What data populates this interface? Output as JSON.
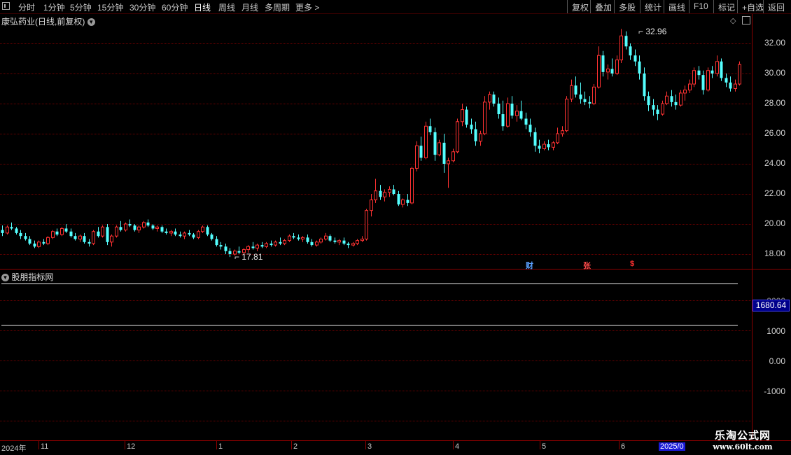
{
  "toolbar": {
    "periods": [
      "分时",
      "1分钟",
      "5分钟",
      "15分钟",
      "30分钟",
      "60分钟",
      "日线",
      "周线",
      "月线",
      "多周期",
      "更多 >"
    ],
    "active_period": "日线",
    "right_buttons": [
      "复权",
      "叠加",
      "多股",
      "统计",
      "画线",
      "F10",
      "标记",
      "+自选",
      "返回"
    ]
  },
  "title": "康弘药业(日线,前复权)",
  "indicator_title": "股朋指标网",
  "price_axis": [
    "32.00",
    "30.00",
    "28.00",
    "26.00",
    "24.00",
    "22.00",
    "20.00",
    "18.00"
  ],
  "high_label": "32.96",
  "low_label": "17.81",
  "indicator_axis": [
    "2000",
    "1000",
    "0.00",
    "-1000"
  ],
  "indicator_current": "1680.64",
  "events": [
    {
      "label": "财",
      "color": "#5aa0ff"
    },
    {
      "label": "张",
      "color": "#ff4a4a"
    },
    {
      "label": "$",
      "color": "#ff3030"
    }
  ],
  "date_axis": [
    "2024年",
    "11",
    "12",
    "1",
    "2",
    "3",
    "4",
    "5",
    "6",
    "2025/0"
  ],
  "watermark": {
    "cn": "乐淘公式网",
    "url": "www.60lt.com"
  },
  "colors": {
    "up": "#ff3232",
    "down": "#54ffff",
    "grid": "#6e0000",
    "axis": "#8b0000"
  },
  "chart_data": {
    "type": "candlestick",
    "ylim": [
      17,
      33
    ],
    "high": 32.96,
    "low": 17.81,
    "candles": [
      [
        19.6,
        19.9,
        19.2,
        19.4
      ],
      [
        19.4,
        19.9,
        19.3,
        19.8
      ],
      [
        19.8,
        20.1,
        19.6,
        19.7
      ],
      [
        19.7,
        19.8,
        19.3,
        19.4
      ],
      [
        19.4,
        19.6,
        19.0,
        19.2
      ],
      [
        19.2,
        19.4,
        18.9,
        19.0
      ],
      [
        19.0,
        19.2,
        18.6,
        18.7
      ],
      [
        18.7,
        18.9,
        18.4,
        18.5
      ],
      [
        18.5,
        18.9,
        18.4,
        18.8
      ],
      [
        18.8,
        19.0,
        18.6,
        18.7
      ],
      [
        18.7,
        19.2,
        18.6,
        19.1
      ],
      [
        19.1,
        19.6,
        19.0,
        19.5
      ],
      [
        19.5,
        19.7,
        19.2,
        19.3
      ],
      [
        19.3,
        19.8,
        19.2,
        19.7
      ],
      [
        19.7,
        20.0,
        19.4,
        19.5
      ],
      [
        19.5,
        19.7,
        19.1,
        19.2
      ],
      [
        19.2,
        19.4,
        18.9,
        19.0
      ],
      [
        19.0,
        19.3,
        18.8,
        19.2
      ],
      [
        19.2,
        19.4,
        18.7,
        18.8
      ],
      [
        18.8,
        19.0,
        18.5,
        18.7
      ],
      [
        18.7,
        19.6,
        18.6,
        19.5
      ],
      [
        19.5,
        19.8,
        19.1,
        19.2
      ],
      [
        19.2,
        19.9,
        19.1,
        19.8
      ],
      [
        19.8,
        20.0,
        18.6,
        18.8
      ],
      [
        18.8,
        19.3,
        18.5,
        19.2
      ],
      [
        19.2,
        19.9,
        19.1,
        19.8
      ],
      [
        19.8,
        20.2,
        19.5,
        19.6
      ],
      [
        19.6,
        20.1,
        19.5,
        20.0
      ],
      [
        20.0,
        20.3,
        19.8,
        19.9
      ],
      [
        19.9,
        20.0,
        19.5,
        19.6
      ],
      [
        19.6,
        19.9,
        19.4,
        19.8
      ],
      [
        19.8,
        20.2,
        19.7,
        20.1
      ],
      [
        20.1,
        20.3,
        19.8,
        19.9
      ],
      [
        19.9,
        20.0,
        19.6,
        19.7
      ],
      [
        19.7,
        19.9,
        19.5,
        19.8
      ],
      [
        19.8,
        19.9,
        19.4,
        19.5
      ],
      [
        19.5,
        19.7,
        19.3,
        19.4
      ],
      [
        19.4,
        19.6,
        19.2,
        19.5
      ],
      [
        19.5,
        19.7,
        19.2,
        19.3
      ],
      [
        19.3,
        19.5,
        19.1,
        19.2
      ],
      [
        19.2,
        19.5,
        19.0,
        19.4
      ],
      [
        19.4,
        19.6,
        19.2,
        19.3
      ],
      [
        19.3,
        19.4,
        19.0,
        19.1
      ],
      [
        19.1,
        19.6,
        19.0,
        19.5
      ],
      [
        19.5,
        19.9,
        19.4,
        19.8
      ],
      [
        19.8,
        19.9,
        19.2,
        19.3
      ],
      [
        19.3,
        19.4,
        18.9,
        19.0
      ],
      [
        19.0,
        19.2,
        18.5,
        18.6
      ],
      [
        18.6,
        18.8,
        18.3,
        18.5
      ],
      [
        18.5,
        18.7,
        18.0,
        18.2
      ],
      [
        18.2,
        18.4,
        17.81,
        18.0
      ],
      [
        18.0,
        18.3,
        17.9,
        18.2
      ],
      [
        18.2,
        18.5,
        18.0,
        18.1
      ],
      [
        18.1,
        18.4,
        18.0,
        18.3
      ],
      [
        18.3,
        18.6,
        18.1,
        18.5
      ],
      [
        18.5,
        18.8,
        18.3,
        18.4
      ],
      [
        18.4,
        18.7,
        18.2,
        18.6
      ],
      [
        18.6,
        18.8,
        18.4,
        18.5
      ],
      [
        18.5,
        18.8,
        18.4,
        18.7
      ],
      [
        18.7,
        18.9,
        18.5,
        18.6
      ],
      [
        18.6,
        18.9,
        18.5,
        18.8
      ],
      [
        18.8,
        19.1,
        18.6,
        18.7
      ],
      [
        18.7,
        19.0,
        18.6,
        18.9
      ],
      [
        18.9,
        19.3,
        18.8,
        19.2
      ],
      [
        19.2,
        19.4,
        19.0,
        19.1
      ],
      [
        19.1,
        19.3,
        18.9,
        19.0
      ],
      [
        19.0,
        19.2,
        18.8,
        19.1
      ],
      [
        19.1,
        19.3,
        18.7,
        18.8
      ],
      [
        18.8,
        19.0,
        18.5,
        18.6
      ],
      [
        18.6,
        18.9,
        18.5,
        18.8
      ],
      [
        18.8,
        19.1,
        18.7,
        19.0
      ],
      [
        19.0,
        19.4,
        18.9,
        19.2
      ],
      [
        19.2,
        19.3,
        18.8,
        18.9
      ],
      [
        18.9,
        19.1,
        18.7,
        18.8
      ],
      [
        18.8,
        19.0,
        18.6,
        18.9
      ],
      [
        18.9,
        19.1,
        18.6,
        18.7
      ],
      [
        18.7,
        18.8,
        18.4,
        18.6
      ],
      [
        18.6,
        18.8,
        18.5,
        18.7
      ],
      [
        18.7,
        19.0,
        18.6,
        18.9
      ],
      [
        18.9,
        19.2,
        18.8,
        19.0
      ],
      [
        19.0,
        21.0,
        18.9,
        20.9
      ],
      [
        20.9,
        22.0,
        20.5,
        21.6
      ],
      [
        21.6,
        23.0,
        21.4,
        22.2
      ],
      [
        22.2,
        22.6,
        21.6,
        21.8
      ],
      [
        21.8,
        22.3,
        21.5,
        22.1
      ],
      [
        22.1,
        22.5,
        21.8,
        22.3
      ],
      [
        22.3,
        22.6,
        21.9,
        22.0
      ],
      [
        22.0,
        22.2,
        21.2,
        21.3
      ],
      [
        21.3,
        21.7,
        21.1,
        21.6
      ],
      [
        21.6,
        22.0,
        21.2,
        21.4
      ],
      [
        21.4,
        23.8,
        21.3,
        23.7
      ],
      [
        23.7,
        25.5,
        23.5,
        25.2
      ],
      [
        25.2,
        25.8,
        24.2,
        24.4
      ],
      [
        24.4,
        26.8,
        24.3,
        26.5
      ],
      [
        26.5,
        27.0,
        25.9,
        26.1
      ],
      [
        26.1,
        26.4,
        24.2,
        24.6
      ],
      [
        24.6,
        25.6,
        24.5,
        25.4
      ],
      [
        25.4,
        26.0,
        23.4,
        24.0
      ],
      [
        24.0,
        24.4,
        22.4,
        24.2
      ],
      [
        24.2,
        25.0,
        24.1,
        24.8
      ],
      [
        24.8,
        27.0,
        24.7,
        26.8
      ],
      [
        26.8,
        28.0,
        26.5,
        27.6
      ],
      [
        27.6,
        27.8,
        26.4,
        26.6
      ],
      [
        26.6,
        27.0,
        26.0,
        26.3
      ],
      [
        26.3,
        26.8,
        25.2,
        25.5
      ],
      [
        25.5,
        26.2,
        25.2,
        26.0
      ],
      [
        26.0,
        28.5,
        25.9,
        28.1
      ],
      [
        28.1,
        28.8,
        27.6,
        28.6
      ],
      [
        28.6,
        28.8,
        27.8,
        28.0
      ],
      [
        28.0,
        28.4,
        27.0,
        27.3
      ],
      [
        27.3,
        28.2,
        26.2,
        26.5
      ],
      [
        26.5,
        28.4,
        26.4,
        28.0
      ],
      [
        28.0,
        28.5,
        27.0,
        27.2
      ],
      [
        27.2,
        27.9,
        26.8,
        27.5
      ],
      [
        27.5,
        28.2,
        26.9,
        27.0
      ],
      [
        27.0,
        27.4,
        26.3,
        26.6
      ],
      [
        26.6,
        27.0,
        25.8,
        26.1
      ],
      [
        26.1,
        26.4,
        24.8,
        25.2
      ],
      [
        25.2,
        25.6,
        24.7,
        25.0
      ],
      [
        25.0,
        25.5,
        24.9,
        25.3
      ],
      [
        25.3,
        25.6,
        24.9,
        25.1
      ],
      [
        25.1,
        25.5,
        24.9,
        25.4
      ],
      [
        25.4,
        26.4,
        25.3,
        26.0
      ],
      [
        26.0,
        26.5,
        25.8,
        26.2
      ],
      [
        26.2,
        28.5,
        26.1,
        28.3
      ],
      [
        28.3,
        29.6,
        28.1,
        29.2
      ],
      [
        29.2,
        29.8,
        28.4,
        28.6
      ],
      [
        28.6,
        29.4,
        28.0,
        28.3
      ],
      [
        28.3,
        28.8,
        27.9,
        28.1
      ],
      [
        28.1,
        28.5,
        27.7,
        28.0
      ],
      [
        28.0,
        29.3,
        27.9,
        29.1
      ],
      [
        29.1,
        31.8,
        29.0,
        31.2
      ],
      [
        31.2,
        31.5,
        29.8,
        30.1
      ],
      [
        30.1,
        30.6,
        29.6,
        30.3
      ],
      [
        30.3,
        31.0,
        29.8,
        30.0
      ],
      [
        30.0,
        31.2,
        29.9,
        30.9
      ],
      [
        30.9,
        32.96,
        30.7,
        32.5
      ],
      [
        32.5,
        32.8,
        31.6,
        31.8
      ],
      [
        31.8,
        32.0,
        30.9,
        31.2
      ],
      [
        31.2,
        31.6,
        30.5,
        30.8
      ],
      [
        30.8,
        31.2,
        29.6,
        30.0
      ],
      [
        30.0,
        30.4,
        28.2,
        28.5
      ],
      [
        28.5,
        28.8,
        27.5,
        27.9
      ],
      [
        27.9,
        28.3,
        27.2,
        27.6
      ],
      [
        27.6,
        27.9,
        26.9,
        27.3
      ],
      [
        27.3,
        28.2,
        27.2,
        28.0
      ],
      [
        28.0,
        28.8,
        27.9,
        28.5
      ],
      [
        28.5,
        28.9,
        27.8,
        28.1
      ],
      [
        28.1,
        28.6,
        27.6,
        27.9
      ],
      [
        27.9,
        28.9,
        27.8,
        28.7
      ],
      [
        28.7,
        29.2,
        28.2,
        28.9
      ],
      [
        28.9,
        29.6,
        28.7,
        29.3
      ],
      [
        29.3,
        30.4,
        29.1,
        30.2
      ],
      [
        30.2,
        30.5,
        29.6,
        29.9
      ],
      [
        29.9,
        30.2,
        28.6,
        28.9
      ],
      [
        28.9,
        30.4,
        28.8,
        30.2
      ],
      [
        30.2,
        30.5,
        29.7,
        30.0
      ],
      [
        30.0,
        31.2,
        29.8,
        30.8
      ],
      [
        30.8,
        31.0,
        29.5,
        29.7
      ],
      [
        29.7,
        30.0,
        29.1,
        29.4
      ],
      [
        29.4,
        29.8,
        28.8,
        29.0
      ],
      [
        29.0,
        29.6,
        28.8,
        29.3
      ],
      [
        29.3,
        30.8,
        29.2,
        30.6
      ]
    ],
    "indicator": {
      "series_count": 2,
      "current": 1680.64,
      "ylim": [
        -1500,
        2500
      ]
    }
  }
}
